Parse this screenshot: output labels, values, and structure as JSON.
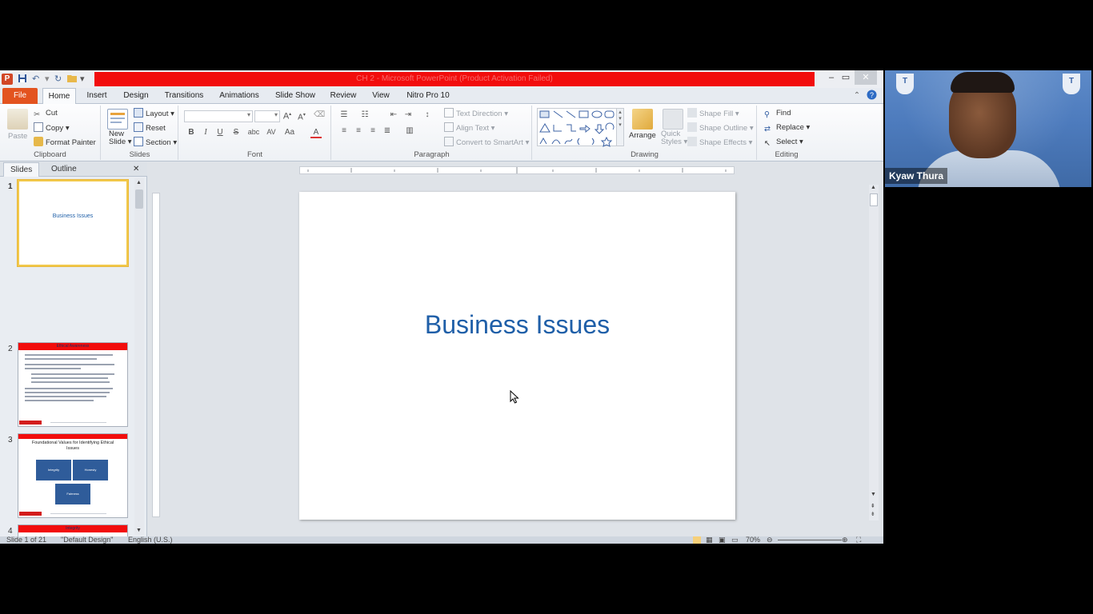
{
  "window": {
    "title": "CH 2 - Microsoft PowerPoint (Product Activation Failed)",
    "app_icon_letter": "P"
  },
  "tabs": [
    "File",
    "Home",
    "Insert",
    "Design",
    "Transitions",
    "Animations",
    "Slide Show",
    "Review",
    "View",
    "Nitro Pro 10"
  ],
  "ribbon": {
    "clipboard": {
      "paste": "Paste",
      "cut": "Cut",
      "copy": "Copy",
      "format_painter": "Format Painter",
      "label": "Clipboard"
    },
    "slides": {
      "new_slide_1": "New",
      "new_slide_2": "Slide",
      "layout": "Layout",
      "reset": "Reset",
      "section": "Section",
      "label": "Slides"
    },
    "font": {
      "bold": "B",
      "italic": "I",
      "underline": "U",
      "strike": "S",
      "shadow": "abc",
      "spacing": "AV",
      "case": "Aa",
      "color": "A",
      "label": "Font"
    },
    "paragraph": {
      "text_direction": "Text Direction",
      "align_text": "Align Text",
      "convert_smartart": "Convert to SmartArt",
      "label": "Paragraph"
    },
    "drawing": {
      "arrange": "Arrange",
      "quick_styles_1": "Quick",
      "quick_styles_2": "Styles",
      "shape_fill": "Shape Fill",
      "shape_outline": "Shape Outline",
      "shape_effects": "Shape Effects",
      "label": "Drawing"
    },
    "editing": {
      "find": "Find",
      "replace": "Replace",
      "select": "Select",
      "label": "Editing"
    }
  },
  "pane": {
    "tab_slides": "Slides",
    "tab_outline": "Outline",
    "thumbs": [
      {
        "num": "1",
        "title": "Business Issues"
      },
      {
        "num": "2",
        "title": "Ethical Awareness"
      },
      {
        "num": "3",
        "title": "Foundational Values for Identifying Ethical Issues",
        "boxes": [
          "Integrity",
          "Honesty",
          "Fairness"
        ]
      },
      {
        "num": "4",
        "title": "Integrity"
      }
    ]
  },
  "slide": {
    "title": "Business Issues"
  },
  "statusbar": {
    "slide_of": "Slide 1 of 21",
    "theme": "\"Default Design\"",
    "language": "English (U.S.)",
    "zoom": "70%"
  },
  "video": {
    "name": "Kyaw Thura",
    "logo_letter": "T"
  },
  "colors": {
    "title_bar_red": "#f20d0d",
    "file_tab": "#e3531f",
    "slide_title": "#1f5fa8"
  }
}
